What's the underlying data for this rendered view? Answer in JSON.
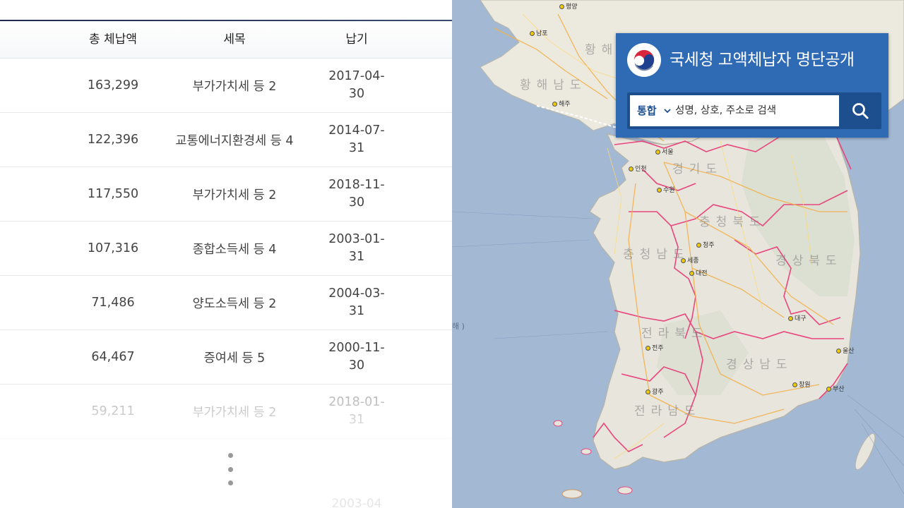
{
  "table": {
    "headers": {
      "amount": "총 체납액",
      "tax_type": "세목",
      "due_date": "납기"
    },
    "rows": [
      {
        "amount": "163,299",
        "tax_type": "부가가치세 등 2",
        "due_date": "2017-04-30"
      },
      {
        "amount": "122,396",
        "tax_type": "교통에너지환경세 등 4",
        "due_date": "2014-07-31"
      },
      {
        "amount": "117,550",
        "tax_type": "부가가치세 등 2",
        "due_date": "2018-11-30"
      },
      {
        "amount": "107,316",
        "tax_type": "종합소득세 등 4",
        "due_date": "2003-01-31"
      },
      {
        "amount": "71,486",
        "tax_type": "양도소득세 등 2",
        "due_date": "2004-03-31"
      },
      {
        "amount": "64,467",
        "tax_type": "증여세 등 5",
        "due_date": "2000-11-30"
      },
      {
        "amount": "59,211",
        "tax_type": "부가가치세 등 2",
        "due_date": "2018-01-31"
      }
    ],
    "partial_date": "2003-04"
  },
  "overlay": {
    "title": "국세청 고액체납자 명단공개",
    "scope_value": "통합",
    "search_placeholder": "성명, 상호, 주소로 검색"
  },
  "map": {
    "cities": [
      {
        "name": "평양"
      },
      {
        "name": "남포"
      },
      {
        "name": "해주"
      },
      {
        "name": "서울"
      },
      {
        "name": "인천"
      },
      {
        "name": "수원"
      },
      {
        "name": "청주"
      },
      {
        "name": "세종"
      },
      {
        "name": "대전"
      },
      {
        "name": "대구"
      },
      {
        "name": "울산"
      },
      {
        "name": "전주"
      },
      {
        "name": "광주"
      },
      {
        "name": "부산"
      },
      {
        "name": "창원"
      }
    ],
    "provinces": [
      {
        "name": "황해남도"
      },
      {
        "name": "황해북도"
      },
      {
        "name": "경기도"
      },
      {
        "name": "충청북도"
      },
      {
        "name": "충청남도"
      },
      {
        "name": "경상북도"
      },
      {
        "name": "전라북도"
      },
      {
        "name": "경상남도"
      },
      {
        "name": "전라남도"
      }
    ],
    "sea_label": "해 )"
  },
  "colors": {
    "overlay_blue": "#2f6ab4",
    "search_dark_blue": "#1d4f8f",
    "sea": "#a3b8d3",
    "boundary_pink": "#e8467c"
  },
  "icons": {
    "search": "magnifier-icon",
    "more": "more-vertical-icon",
    "logo": "taegeuk-logo"
  }
}
